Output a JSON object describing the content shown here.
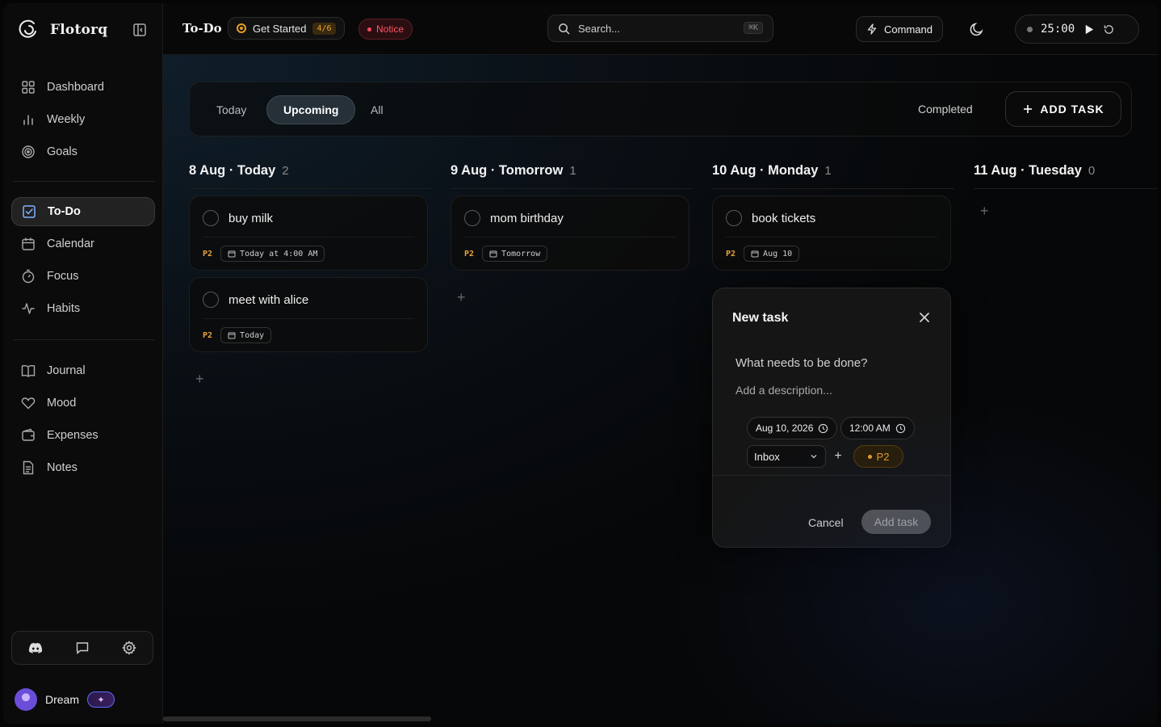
{
  "app": {
    "name": "Flotorq"
  },
  "sidebar": {
    "nav_primary": [
      {
        "label": "Dashboard",
        "icon": "dashboard-icon"
      },
      {
        "label": "Weekly",
        "icon": "bar-chart-icon"
      },
      {
        "label": "Goals",
        "icon": "target-icon"
      }
    ],
    "nav_secondary": [
      {
        "label": "To-Do",
        "icon": "checkbox-icon",
        "active": true
      },
      {
        "label": "Calendar",
        "icon": "calendar-icon"
      },
      {
        "label": "Focus",
        "icon": "timer-icon"
      },
      {
        "label": "Habits",
        "icon": "activity-icon"
      }
    ],
    "nav_tertiary": [
      {
        "label": "Journal",
        "icon": "book-icon"
      },
      {
        "label": "Mood",
        "icon": "heart-icon"
      },
      {
        "label": "Expenses",
        "icon": "wallet-icon"
      },
      {
        "label": "Notes",
        "icon": "note-icon"
      }
    ],
    "footer_tools": [
      "discord-icon",
      "feedback-icon",
      "settings-icon"
    ],
    "user": {
      "name": "Dream",
      "badge": "✦"
    }
  },
  "topbar": {
    "title": "To-Do",
    "get_started": {
      "label": "Get Started",
      "progress": "4/6"
    },
    "notice": "Notice",
    "search": {
      "placeholder": "Search...",
      "shortcut": "⌘K"
    },
    "command": "Command",
    "timer": "25:00"
  },
  "filters": {
    "tabs": [
      {
        "label": "Today",
        "active": false
      },
      {
        "label": "Upcoming",
        "active": true
      },
      {
        "label": "All",
        "active": false
      }
    ],
    "completed": "Completed",
    "add_task": "ADD TASK"
  },
  "columns": [
    {
      "date": "8 Aug",
      "label": "Today",
      "count": "2",
      "tasks": [
        {
          "title": "buy milk",
          "priority": "P2",
          "due": "Today at 4:00 AM"
        },
        {
          "title": "meet with alice",
          "priority": "P2",
          "due": "Today"
        }
      ]
    },
    {
      "date": "9 Aug",
      "label": "Tomorrow",
      "count": "1",
      "tasks": [
        {
          "title": "mom birthday",
          "priority": "P2",
          "due": "Tomorrow"
        }
      ]
    },
    {
      "date": "10 Aug",
      "label": "Monday",
      "count": "1",
      "tasks": [
        {
          "title": "book tickets",
          "priority": "P2",
          "due": "Aug 10"
        }
      ]
    },
    {
      "date": "11 Aug",
      "label": "Tuesday",
      "count": "0",
      "tasks": []
    }
  ],
  "new_task": {
    "title": "New task",
    "title_placeholder": "What needs to be done?",
    "description_placeholder": "Add a description...",
    "date": "Aug 10, 2026",
    "time": "12:00 AM",
    "project": "Inbox",
    "priority": "P2",
    "cancel": "Cancel",
    "submit": "Add task"
  },
  "colors": {
    "accent_priority": "#e8a23a",
    "notice": "#ff5566",
    "active_tab": "#253038"
  }
}
